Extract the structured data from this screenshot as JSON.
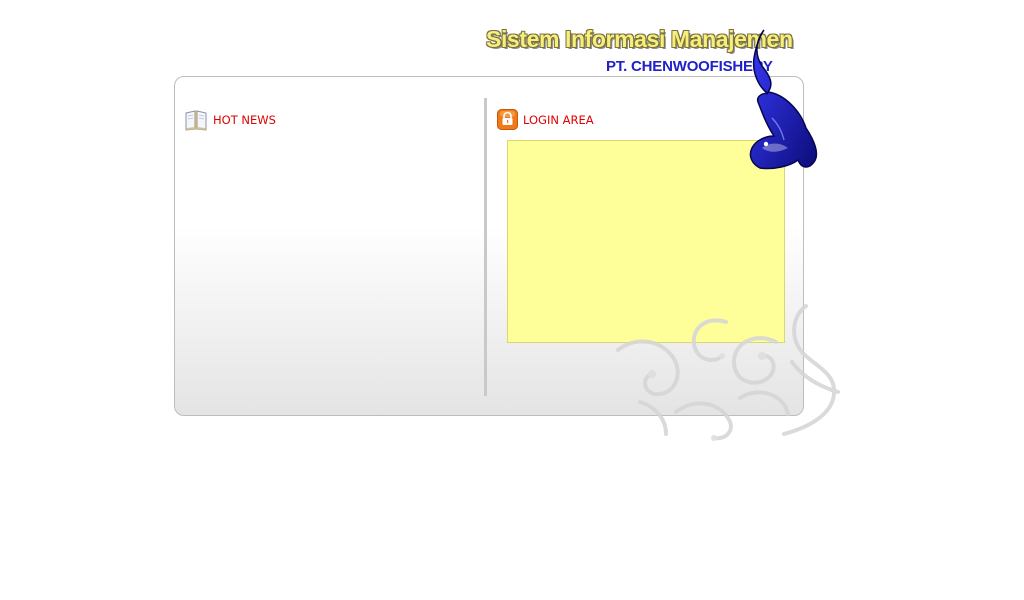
{
  "header": {
    "title": "Sistem Informasi Manajemen",
    "company": "PT. CHENWOOFISHERY"
  },
  "news": {
    "heading": "HOT NEWS",
    "icon": "open-book-icon"
  },
  "login": {
    "heading": "LOGIN AREA",
    "icon": "padlock-icon",
    "box_color": "#ffff99"
  },
  "colors": {
    "heading_text": "#e00000",
    "title_fill": "#f6ef7a",
    "company_text": "#1f22c8",
    "logo": "#1a1aa6"
  }
}
